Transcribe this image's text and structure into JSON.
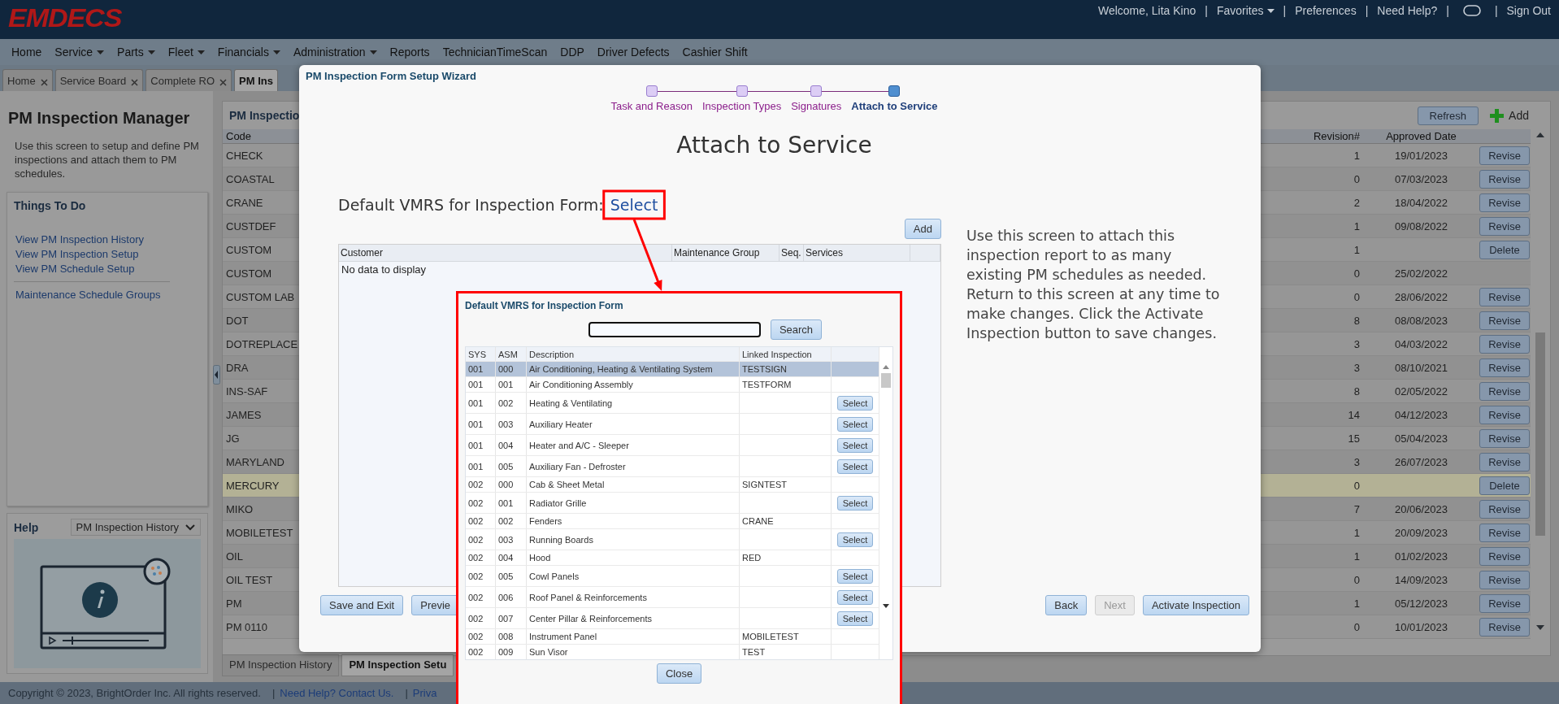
{
  "header": {
    "logo": "EMDECS",
    "items": [
      {
        "kind": "text",
        "label": "Welcome, Lita Kino"
      },
      {
        "kind": "sep",
        "label": "|"
      },
      {
        "kind": "menu",
        "label": "Favorites"
      },
      {
        "kind": "sep",
        "label": "|"
      },
      {
        "kind": "link",
        "label": "Preferences"
      },
      {
        "kind": "sep",
        "label": "|"
      },
      {
        "kind": "link",
        "label": "Need Help?"
      },
      {
        "kind": "sep",
        "label": "|"
      },
      {
        "kind": "icon"
      },
      {
        "kind": "sep",
        "label": "|"
      },
      {
        "kind": "link",
        "label": "Sign Out"
      }
    ]
  },
  "menu": [
    {
      "label": "Home",
      "dropdown": false
    },
    {
      "label": "Service",
      "dropdown": true
    },
    {
      "label": "Parts",
      "dropdown": true
    },
    {
      "label": "Fleet",
      "dropdown": true
    },
    {
      "label": "Financials",
      "dropdown": true
    },
    {
      "label": "Administration",
      "dropdown": true
    },
    {
      "label": "Reports",
      "dropdown": false
    },
    {
      "label": "TechnicianTimeScan",
      "dropdown": false
    },
    {
      "label": "DDP",
      "dropdown": false
    },
    {
      "label": "Driver Defects",
      "dropdown": false
    },
    {
      "label": "Cashier Shift",
      "dropdown": false
    }
  ],
  "tabs": [
    {
      "label": "Home",
      "closable": true,
      "selected": false
    },
    {
      "label": "Service Board",
      "closable": true,
      "selected": false
    },
    {
      "label": "Complete RO",
      "closable": true,
      "selected": false
    },
    {
      "label": "PM Ins",
      "closable": false,
      "selected": true
    }
  ],
  "sidebar": {
    "title": "PM Inspection Manager",
    "description": "Use this screen to setup and define PM inspections and attach them to PM schedules.",
    "todo": {
      "title": "Things To Do",
      "groups": [
        [
          "View PM Inspection History",
          "View PM Inspection Setup",
          "View PM Schedule Setup"
        ],
        [
          "Maintenance Schedule Groups"
        ]
      ]
    },
    "help": {
      "title": "Help",
      "dropdown": "PM Inspection History"
    }
  },
  "grid": {
    "title": "PM Inspectio",
    "refresh": "Refresh",
    "add": "Add",
    "columns": [
      "Code",
      "Revision#",
      "Approved Date"
    ],
    "rows": [
      {
        "code": "CHECK",
        "revision": "1",
        "approved": "19/01/2023",
        "action": "Revise",
        "selected": false
      },
      {
        "code": "COASTAL",
        "revision": "0",
        "approved": "07/03/2023",
        "action": "Revise",
        "selected": false
      },
      {
        "code": "CRANE",
        "revision": "2",
        "approved": "18/04/2022",
        "action": "Revise",
        "selected": false
      },
      {
        "code": "CUSTDEF",
        "revision": "1",
        "approved": "09/08/2022",
        "action": "Revise",
        "selected": false
      },
      {
        "code": "CUSTOM",
        "revision": "1",
        "action": "Delete",
        "selected": false
      },
      {
        "code": "CUSTOM",
        "revision": "0",
        "approved": "25/02/2022",
        "selected": false
      },
      {
        "code": "CUSTOM LAB",
        "revision": "0",
        "approved": "28/06/2022",
        "action": "Revise",
        "selected": false
      },
      {
        "code": "DOT",
        "revision": "8",
        "approved": "08/08/2023",
        "action": "Revise",
        "selected": false
      },
      {
        "code": "DOTREPLACE",
        "revision": "3",
        "approved": "04/03/2022",
        "action": "Revise",
        "selected": false
      },
      {
        "code": "DRA",
        "revision": "3",
        "approved": "08/10/2021",
        "action": "Revise",
        "selected": false
      },
      {
        "code": "INS-SAF",
        "revision": "8",
        "approved": "02/05/2022",
        "action": "Revise",
        "selected": false
      },
      {
        "code": "JAMES",
        "revision": "14",
        "approved": "04/12/2023",
        "action": "Revise",
        "selected": false
      },
      {
        "code": "JG",
        "revision": "15",
        "approved": "05/04/2023",
        "action": "Revise",
        "selected": false
      },
      {
        "code": "MARYLAND",
        "revision": "3",
        "approved": "26/07/2023",
        "action": "Revise",
        "selected": false
      },
      {
        "code": "MERCURY",
        "revision": "0",
        "action": "Delete",
        "selected": true
      },
      {
        "code": "MIKO",
        "revision": "7",
        "approved": "20/06/2023",
        "action": "Revise",
        "selected": false
      },
      {
        "code": "MOBILETEST",
        "revision": "1",
        "approved": "20/09/2023",
        "action": "Revise",
        "selected": false
      },
      {
        "code": "OIL",
        "revision": "1",
        "approved": "01/02/2023",
        "action": "Revise",
        "selected": false
      },
      {
        "code": "OIL TEST",
        "revision": "0",
        "approved": "14/09/2023",
        "action": "Revise",
        "selected": false
      },
      {
        "code": "PM",
        "revision": "1",
        "approved": "05/12/2023",
        "action": "Revise",
        "selected": false
      },
      {
        "code": "PM 0110",
        "revision": "0",
        "approved": "10/01/2023",
        "action": "Revise",
        "selected": false
      }
    ]
  },
  "bottom_tabs": [
    {
      "label": "PM Inspection History",
      "selected": false
    },
    {
      "label": "PM Inspection Setu",
      "selected": true
    }
  ],
  "footer": [
    {
      "kind": "text",
      "label": "Copyright © 2023, BrightOrder Inc. All rights reserved."
    },
    {
      "kind": "sep",
      "label": "|"
    },
    {
      "kind": "link",
      "label": "Need Help? Contact Us."
    },
    {
      "kind": "sep",
      "label": "|"
    },
    {
      "kind": "link",
      "label": "Priva"
    }
  ],
  "wizard": {
    "title": "PM Inspection Form Setup Wizard",
    "steps": [
      {
        "label": "Task and Reason",
        "selected": false
      },
      {
        "label": "Inspection Types",
        "selected": false
      },
      {
        "label": "Signatures",
        "selected": false
      },
      {
        "label": "Attach to Service",
        "selected": true
      }
    ],
    "heading": "Attach to Service",
    "vmrs_label": "Default VMRS for Inspection Form:",
    "vmrs_link": "Select",
    "add": "Add",
    "columns": [
      "Customer",
      "Maintenance Group",
      "Seq.",
      "Services"
    ],
    "empty": "No data to display",
    "info": "Use this screen to attach this inspection report to as many existing PM schedules as needed. Return to this screen at any time to make changes. Click the Activate Inspection button to save changes.",
    "left_buttons": [
      {
        "label": "Save and Exit",
        "disabled": false
      },
      {
        "label": "Previe",
        "disabled": false
      }
    ],
    "right_buttons": [
      {
        "label": "Back",
        "disabled": false
      },
      {
        "label": "Next",
        "disabled": true
      },
      {
        "label": "Activate Inspection",
        "disabled": false
      }
    ]
  },
  "popup": {
    "title": "Default VMRS for Inspection Form",
    "search_button": "Search",
    "columns": [
      "SYS",
      "ASM",
      "Description",
      "Linked Inspection"
    ],
    "rows": [
      {
        "sys": "001",
        "asm": "000",
        "description": "Air Conditioning, Heating & Ventilating System",
        "linked": "TESTSIGN",
        "selected": true
      },
      {
        "sys": "001",
        "asm": "001",
        "description": "Air Conditioning Assembly",
        "linked": "TESTFORM",
        "selected": false
      },
      {
        "sys": "001",
        "asm": "002",
        "description": "Heating & Ventilating",
        "action": "Select",
        "selected": false
      },
      {
        "sys": "001",
        "asm": "003",
        "description": "Auxiliary Heater",
        "action": "Select",
        "selected": false
      },
      {
        "sys": "001",
        "asm": "004",
        "description": "Heater and A/C - Sleeper",
        "action": "Select",
        "selected": false
      },
      {
        "sys": "001",
        "asm": "005",
        "description": "Auxiliary Fan - Defroster",
        "action": "Select",
        "selected": false
      },
      {
        "sys": "002",
        "asm": "000",
        "description": "Cab & Sheet Metal",
        "linked": "SIGNTEST",
        "selected": false
      },
      {
        "sys": "002",
        "asm": "001",
        "description": "Radiator Grille",
        "action": "Select",
        "selected": false
      },
      {
        "sys": "002",
        "asm": "002",
        "description": "Fenders",
        "linked": "CRANE",
        "selected": false
      },
      {
        "sys": "002",
        "asm": "003",
        "description": "Running Boards",
        "action": "Select",
        "selected": false
      },
      {
        "sys": "002",
        "asm": "004",
        "description": "Hood",
        "linked": "RED",
        "selected": false
      },
      {
        "sys": "002",
        "asm": "005",
        "description": "Cowl Panels",
        "action": "Select",
        "selected": false
      },
      {
        "sys": "002",
        "asm": "006",
        "description": "Roof Panel & Reinforcements",
        "action": "Select",
        "selected": false
      },
      {
        "sys": "002",
        "asm": "007",
        "description": "Center Pillar & Reinforcements",
        "action": "Select",
        "selected": false
      },
      {
        "sys": "002",
        "asm": "008",
        "description": "Instrument Panel",
        "linked": "MOBILETEST",
        "selected": false
      },
      {
        "sys": "002",
        "asm": "009",
        "description": "Sun Visor",
        "linked": "TEST",
        "selected": false
      }
    ],
    "close": "Close"
  }
}
